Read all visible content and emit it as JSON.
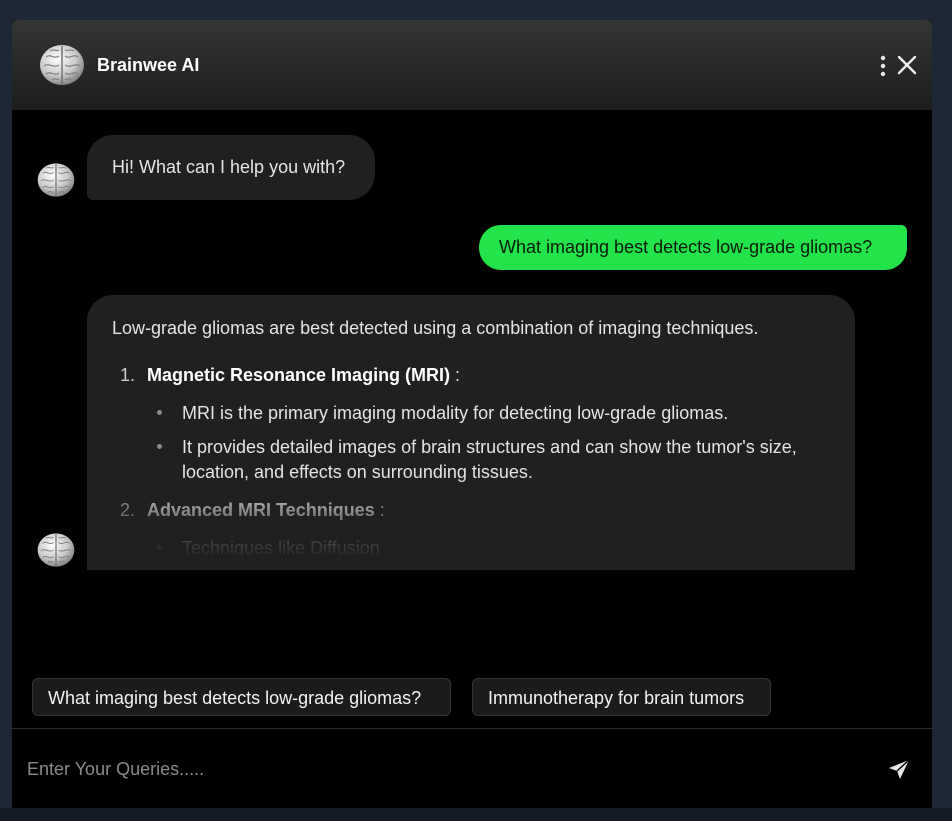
{
  "header": {
    "title": "Brainwee AI",
    "logo_icon": "brain-icon",
    "menu_icon": "more-vertical-icon",
    "close_icon": "close-icon"
  },
  "messages": {
    "greeting": "Hi! What can I help you with?",
    "user_question": "What imaging best detects low-grade gliomas?",
    "answer": {
      "intro": "Low-grade gliomas are best detected using a combination of imaging techniques.",
      "items": [
        {
          "number": "1.",
          "title": "Magnetic Resonance Imaging (MRI)",
          "suffix": " :",
          "bullets": [
            "MRI is the primary imaging modality for detecting low-grade gliomas.",
            "It provides detailed images of brain structures and can show the tumor's size,",
            "location, and effects on surrounding tissues."
          ]
        },
        {
          "number": "2.",
          "title": "Advanced MRI Techniques",
          "suffix": " :",
          "bullets": [
            "Techniques like Diffusion"
          ]
        }
      ]
    }
  },
  "suggestions": [
    "What imaging best detects low-grade gliomas?",
    "Immunotherapy for brain tumors"
  ],
  "input": {
    "placeholder": "Enter Your Queries.....",
    "value": "",
    "send_icon": "send-icon"
  },
  "colors": {
    "user_bubble": "#22e34a",
    "bot_bubble": "#202022",
    "background": "#000000"
  }
}
